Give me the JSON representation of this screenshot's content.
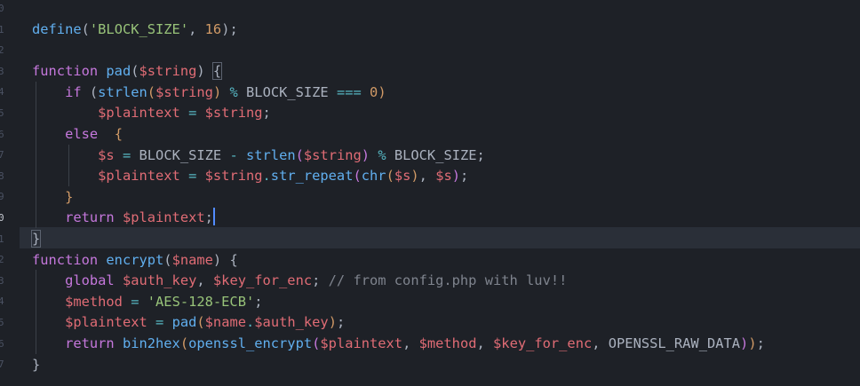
{
  "editor": {
    "language": "php",
    "theme_colors": {
      "background": "#1e2127",
      "keyword": "#c678dd",
      "function": "#61afef",
      "variable": "#e06c75",
      "string": "#98c379",
      "number": "#d19a66",
      "operator": "#56b6c2",
      "comment": "#7f848e",
      "caret": "#528bff"
    },
    "gutter_fragments": [
      "0",
      "1",
      "2",
      "3",
      "4",
      "5",
      "6",
      "7",
      "8",
      "9",
      "0",
      "1",
      "2",
      "3",
      "4",
      "5",
      "6",
      "7"
    ],
    "cursor_line": 10,
    "lines": [
      [
        [
          "fn",
          "define"
        ],
        [
          "pl",
          "("
        ],
        [
          "str",
          "'BLOCK_SIZE'"
        ],
        [
          "pl",
          ", "
        ],
        [
          "num",
          "16"
        ],
        [
          "pl",
          ");"
        ]
      ],
      [],
      [
        [
          "kw",
          "function "
        ],
        [
          "fn",
          "pad"
        ],
        [
          "pl",
          "("
        ],
        [
          "var",
          "$string"
        ],
        [
          "pl",
          ") "
        ],
        [
          "brm",
          "{"
        ]
      ],
      [
        [
          "kw",
          "if "
        ],
        [
          "pl",
          "("
        ],
        [
          "fn",
          "strlen"
        ],
        [
          "br1",
          "("
        ],
        [
          "var",
          "$string"
        ],
        [
          "br1",
          ")"
        ],
        [
          "op",
          " % "
        ],
        [
          "pl",
          "BLOCK_SIZE"
        ],
        [
          "op",
          " === "
        ],
        [
          "num",
          "0"
        ],
        [
          "br1",
          ")"
        ]
      ],
      [
        [
          "var",
          "$plaintext"
        ],
        [
          "op",
          " = "
        ],
        [
          "var",
          "$string"
        ],
        [
          "pl",
          ";"
        ]
      ],
      [
        [
          "kw",
          "else  "
        ],
        [
          "br1",
          "{"
        ]
      ],
      [
        [
          "var",
          "$s"
        ],
        [
          "op",
          " = "
        ],
        [
          "pl",
          "BLOCK_SIZE"
        ],
        [
          "op",
          " - "
        ],
        [
          "fn",
          "strlen"
        ],
        [
          "br2",
          "("
        ],
        [
          "var",
          "$string"
        ],
        [
          "br2",
          ")"
        ],
        [
          "op",
          " % "
        ],
        [
          "pl",
          "BLOCK_SIZE;"
        ]
      ],
      [
        [
          "var",
          "$plaintext"
        ],
        [
          "op",
          " = "
        ],
        [
          "var",
          "$string"
        ],
        [
          "op",
          "."
        ],
        [
          "fn",
          "str_repeat"
        ],
        [
          "br2",
          "("
        ],
        [
          "fn",
          "chr"
        ],
        [
          "br1",
          "("
        ],
        [
          "var",
          "$s"
        ],
        [
          "br1",
          ")"
        ],
        [
          "pl",
          ", "
        ],
        [
          "var",
          "$s"
        ],
        [
          "br2",
          ")"
        ],
        [
          "pl",
          ";"
        ]
      ],
      [
        [
          "br1",
          "}"
        ]
      ],
      [
        [
          "kw",
          "return "
        ],
        [
          "var",
          "$plaintext"
        ],
        [
          "pl",
          ";"
        ]
      ],
      [
        [
          "brm",
          "}"
        ]
      ],
      [
        [
          "kw",
          "function "
        ],
        [
          "fn",
          "encrypt"
        ],
        [
          "pl",
          "("
        ],
        [
          "var",
          "$name"
        ],
        [
          "pl",
          ") {"
        ]
      ],
      [
        [
          "kw",
          "global "
        ],
        [
          "var",
          "$auth_key"
        ],
        [
          "pl",
          ", "
        ],
        [
          "var",
          "$key_for_enc"
        ],
        [
          "pl",
          "; "
        ],
        [
          "cm",
          "// from config.php with luv!!"
        ]
      ],
      [
        [
          "var",
          "$method"
        ],
        [
          "op",
          " = "
        ],
        [
          "str",
          "'AES-128-ECB'"
        ],
        [
          "pl",
          ";"
        ]
      ],
      [
        [
          "var",
          "$plaintext"
        ],
        [
          "op",
          " = "
        ],
        [
          "fn",
          "pad"
        ],
        [
          "br1",
          "("
        ],
        [
          "var",
          "$name"
        ],
        [
          "op",
          "."
        ],
        [
          "var",
          "$auth_key"
        ],
        [
          "br1",
          ")"
        ],
        [
          "pl",
          ";"
        ]
      ],
      [
        [
          "kw",
          "return "
        ],
        [
          "fn",
          "bin2hex"
        ],
        [
          "br1",
          "("
        ],
        [
          "fn",
          "openssl_encrypt"
        ],
        [
          "br2",
          "("
        ],
        [
          "var",
          "$plaintext"
        ],
        [
          "pl",
          ", "
        ],
        [
          "var",
          "$method"
        ],
        [
          "pl",
          ", "
        ],
        [
          "var",
          "$key_for_enc"
        ],
        [
          "pl",
          ", OPENSSL_RAW_DATA"
        ],
        [
          "br2",
          ")"
        ],
        [
          "br1",
          ")"
        ],
        [
          "pl",
          ";"
        ]
      ],
      [
        [
          "pl",
          "}"
        ]
      ]
    ]
  }
}
